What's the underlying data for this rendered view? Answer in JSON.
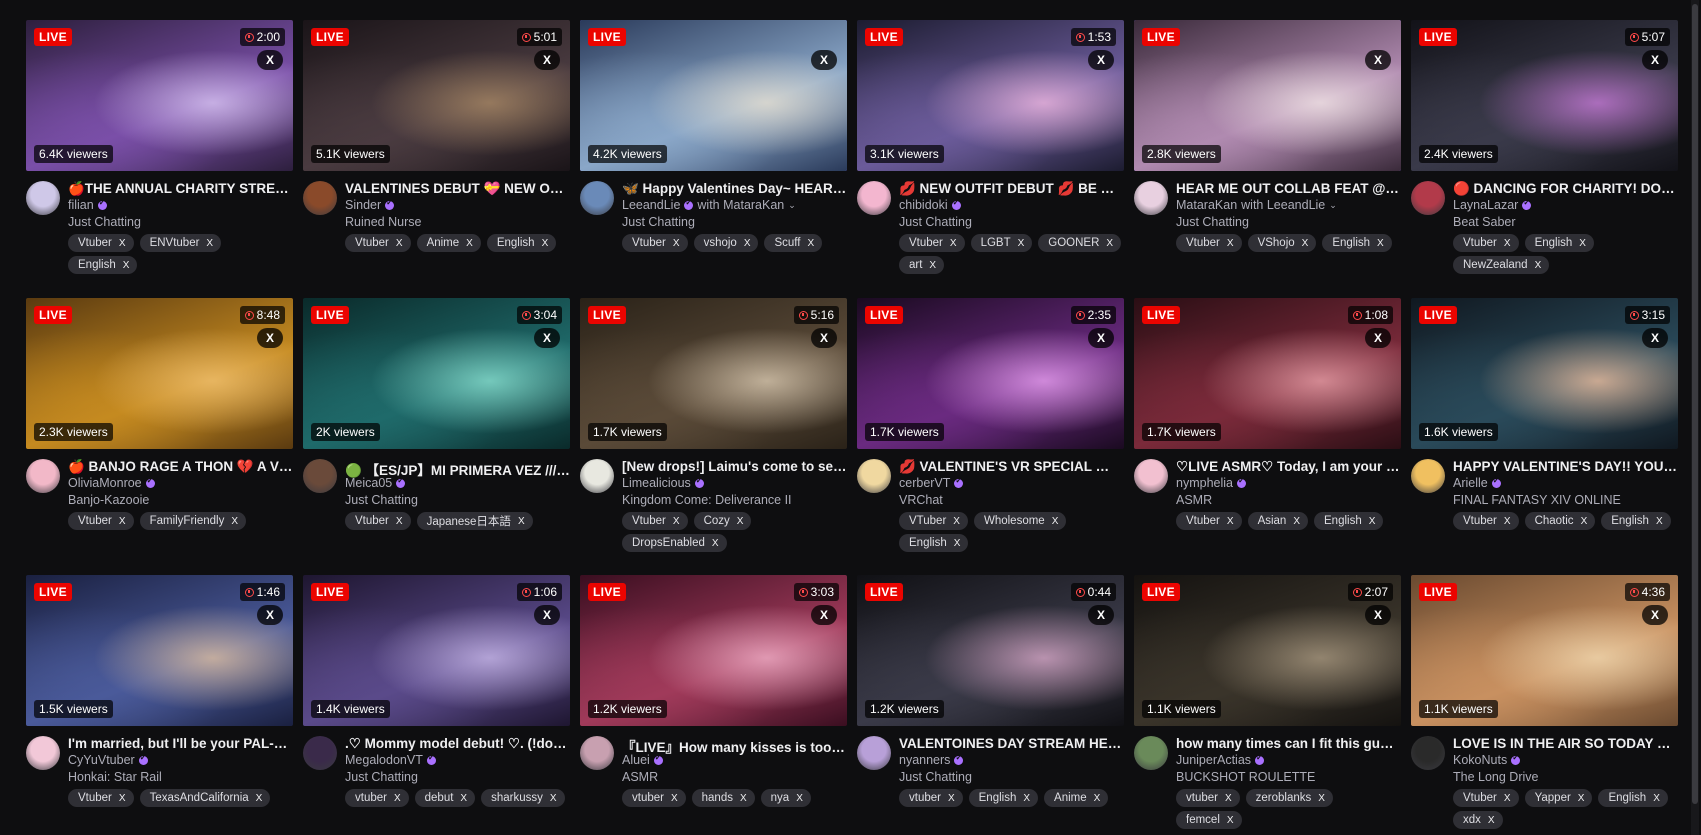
{
  "colors": {
    "background": "#0e0e10",
    "live_badge": "#eb0400",
    "highlight_border": "#6f57ff",
    "verified": "#a970ff",
    "tag_bg": "#2f2f35"
  },
  "live_label": "LIVE",
  "dismiss_label": "X",
  "streams": [
    {
      "title": "🍎THE ANNUAL CHARITY STREA...",
      "channel": "filian",
      "verified": true,
      "with": "",
      "category": "Just Chatting",
      "duration": "2:00",
      "viewers": "6.4K viewers",
      "tags": [
        "Vtuber",
        "ENVtuber",
        "English"
      ],
      "highlight": false,
      "thumb": [
        "#2d1f3d",
        "#7a4fa8",
        "#d9c6f2"
      ],
      "avatar": "#cfc8e8"
    },
    {
      "title": "VALENTINES DEBUT 💝 NEW ONE ...",
      "channel": "Sinder",
      "verified": true,
      "with": "",
      "category": "Ruined Nurse",
      "duration": "5:01",
      "viewers": "5.1K viewers",
      "tags": [
        "Vtuber",
        "Anime",
        "English"
      ],
      "highlight": false,
      "thumb": [
        "#1a1418",
        "#4a3b40",
        "#a88865"
      ],
      "avatar": "#8a4a2a"
    },
    {
      "title": "🦋 Happy Valentines Day~ HEAR ...",
      "channel": "LeeandLie",
      "verified": true,
      "with": "with MataraKan",
      "category": "Just Chatting",
      "duration": "",
      "viewers": "4.2K viewers",
      "tags": [
        "Vtuber",
        "vshojo",
        "Scuff"
      ],
      "highlight": true,
      "thumb": [
        "#2a3a5a",
        "#8aa7c8",
        "#e8e0d0"
      ],
      "avatar": "#6a8ab8"
    },
    {
      "title": "💋 NEW OUTFIT DEBUT 💋 BE MY ...",
      "channel": "chibidoki",
      "verified": true,
      "with": "",
      "category": "Just Chatting",
      "duration": "1:53",
      "viewers": "3.1K viewers",
      "tags": [
        "Vtuber",
        "LGBT",
        "GOONER",
        "art"
      ],
      "highlight": false,
      "thumb": [
        "#1c1c30",
        "#6b5b9a",
        "#f0b8e0"
      ],
      "avatar": "#f3b6cf"
    },
    {
      "title": "HEAR ME OUT COLLAB FEAT @lee...",
      "channel": "MataraKan",
      "verified": false,
      "with": "with LeeandLie",
      "category": "Just Chatting",
      "duration": "",
      "viewers": "2.8K viewers",
      "tags": [
        "Vtuber",
        "VShojo",
        "English"
      ],
      "highlight": true,
      "thumb": [
        "#3a2a3a",
        "#b08ab0",
        "#f2e6e6"
      ],
      "avatar": "#e8d0e0"
    },
    {
      "title": "🔴 DANCING FOR CHARITY! DONA...",
      "channel": "LaynaLazar",
      "verified": true,
      "with": "",
      "category": "Beat Saber",
      "duration": "5:07",
      "viewers": "2.4K viewers",
      "tags": [
        "Vtuber",
        "English",
        "NewZealand"
      ],
      "highlight": false,
      "thumb": [
        "#121218",
        "#3a3a4a",
        "#c77ad8"
      ],
      "avatar": "#b23a4a"
    },
    {
      "title": "🍎 BANJO RAGE A THON 💔 A VE...",
      "channel": "OliviaMonroe",
      "verified": true,
      "with": "",
      "category": "Banjo-Kazooie",
      "duration": "8:48",
      "viewers": "2.3K viewers",
      "tags": [
        "Vtuber",
        "FamilyFriendly"
      ],
      "highlight": false,
      "thumb": [
        "#5a3a10",
        "#c58a20",
        "#f0c070"
      ],
      "avatar": "#f2b8c8"
    },
    {
      "title": "🟢 【ES/JP】MI PRIMERA VEZ //// ...",
      "channel": "Meica05",
      "verified": true,
      "with": "",
      "category": "Just Chatting",
      "duration": "3:04",
      "viewers": "2K viewers",
      "tags": [
        "Vtuber",
        "Japanese日本語"
      ],
      "highlight": false,
      "thumb": [
        "#0a2a2a",
        "#1f6a6a",
        "#8ae0d0"
      ],
      "avatar": "#6a4a3a"
    },
    {
      "title": "[New drops!] Laimu's come to see ...",
      "channel": "Limealicious",
      "verified": true,
      "with": "",
      "category": "Kingdom Come: Deliverance II",
      "duration": "5:16",
      "viewers": "1.7K viewers",
      "tags": [
        "Vtuber",
        "Cozy",
        "DropsEnabled"
      ],
      "highlight": false,
      "thumb": [
        "#2a2218",
        "#5a4a38",
        "#d8c8b0"
      ],
      "avatar": "#e8e8e0"
    },
    {
      "title": "💋 VALENTINE'S VR SPECIAL 💋 (...",
      "channel": "cerberVT",
      "verified": true,
      "with": "",
      "category": "VRChat",
      "duration": "2:35",
      "viewers": "1.7K viewers",
      "tags": [
        "VTuber",
        "Wholesome",
        "English"
      ],
      "highlight": false,
      "thumb": [
        "#1a0a20",
        "#6a2a80",
        "#e8a0f0"
      ],
      "avatar": "#f0d8a0"
    },
    {
      "title": "♡LIVE ASMR♡ Today, I am your girl...",
      "channel": "nymphelia",
      "verified": true,
      "with": "",
      "category": "ASMR",
      "duration": "1:08",
      "viewers": "1.7K viewers",
      "tags": [
        "Vtuber",
        "Asian",
        "English"
      ],
      "highlight": false,
      "thumb": [
        "#2a0e14",
        "#7a2a3a",
        "#e8a0a8"
      ],
      "avatar": "#f2c0d0"
    },
    {
      "title": "HAPPY VALENTINE'S DAY!! YOU'R...",
      "channel": "Arielle",
      "verified": true,
      "with": "",
      "category": "FINAL FANTASY XIV ONLINE",
      "duration": "3:15",
      "viewers": "1.6K viewers",
      "tags": [
        "Vtuber",
        "Chaotic",
        "English"
      ],
      "highlight": false,
      "thumb": [
        "#101820",
        "#2a4a5a",
        "#f0c0a0"
      ],
      "avatar": "#f0c060"
    },
    {
      "title": "I'm married, but I'll be your PAL-ent...",
      "channel": "CyYuVtuber",
      "verified": true,
      "with": "",
      "category": "Honkai: Star Rail",
      "duration": "1:46",
      "viewers": "1.5K viewers",
      "tags": [
        "Vtuber",
        "TexasAndCalifornia"
      ],
      "highlight": false,
      "thumb": [
        "#1a2040",
        "#4a5a9a",
        "#e0c0a0"
      ],
      "avatar": "#f2c8d8"
    },
    {
      "title": ".♡ Mommy model debut! ♡. (!dona...",
      "channel": "MegalodonVT",
      "verified": true,
      "with": "",
      "category": "Just Chatting",
      "duration": "1:06",
      "viewers": "1.4K viewers",
      "tags": [
        "vtuber",
        "debut",
        "sharkussy"
      ],
      "highlight": false,
      "thumb": [
        "#1e1630",
        "#5a4a8a",
        "#c8b8e8"
      ],
      "avatar": "#3a2a4a"
    },
    {
      "title": "『LIVE』How many kisses is too m...",
      "channel": "Aluei",
      "verified": true,
      "with": "",
      "category": "ASMR",
      "duration": "3:03",
      "viewers": "1.2K viewers",
      "tags": [
        "vtuber",
        "hands",
        "nya"
      ],
      "highlight": false,
      "thumb": [
        "#3a0e20",
        "#a03a5a",
        "#f0b0c8"
      ],
      "avatar": "#c8a0b0"
    },
    {
      "title": "VALENTOINES DAY STREAM HEHE...",
      "channel": "nyanners",
      "verified": true,
      "with": "",
      "category": "Just Chatting",
      "duration": "0:44",
      "viewers": "1.2K viewers",
      "tags": [
        "vtuber",
        "English",
        "Anime"
      ],
      "highlight": false,
      "thumb": [
        "#101014",
        "#3a3a48",
        "#d8a8c8"
      ],
      "avatar": "#b8a0d8"
    },
    {
      "title": "how many times can I fit this gun i...",
      "channel": "JuniperActias",
      "verified": true,
      "with": "",
      "category": "BUCKSHOT ROULETTE",
      "duration": "2:07",
      "viewers": "1.1K viewers",
      "tags": [
        "vtuber",
        "zeroblanks",
        "femcel"
      ],
      "highlight": false,
      "thumb": [
        "#141210",
        "#3a342a",
        "#a89880"
      ],
      "avatar": "#6a8a5a"
    },
    {
      "title": "LOVE IS IN THE AIR SO TODAY WE'...",
      "channel": "KokoNuts",
      "verified": true,
      "with": "",
      "category": "The Long Drive",
      "duration": "4:36",
      "viewers": "1.1K viewers",
      "tags": [
        "Vtuber",
        "Yapper",
        "English",
        "xdx"
      ],
      "highlight": false,
      "thumb": [
        "#6a4a30",
        "#c89060",
        "#f0d8b0"
      ],
      "avatar": "#2a2a2a"
    }
  ]
}
